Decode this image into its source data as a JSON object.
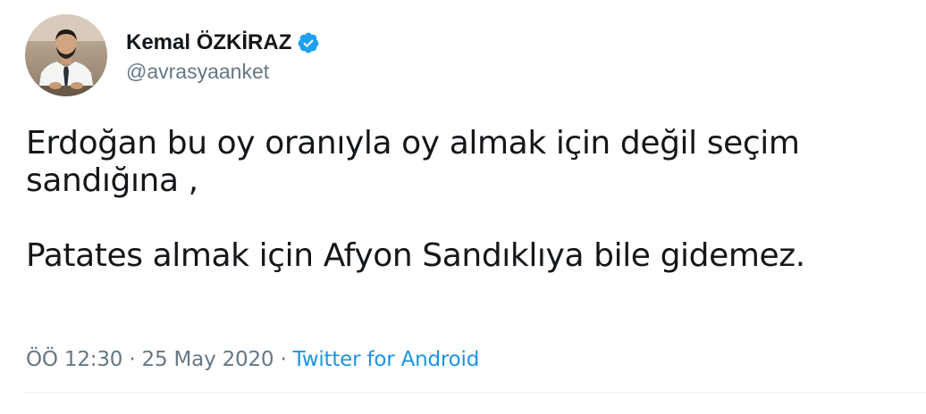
{
  "user": {
    "display_name": "Kemal ÖZKİRAZ",
    "handle": "@avrasyaanket",
    "verified": true,
    "avatar_icon": "profile-photo",
    "verified_icon": "verified-badge-icon"
  },
  "tweet": {
    "text": "Erdoğan bu oy oranıyla oy almak için değil seçim sandığına ,\n\nPatates almak için Afyon Sandıklıya bile gidemez.",
    "time": "ÖÖ 12:30",
    "separator_1": " · ",
    "date": "25 May 2020",
    "separator_2": " · ",
    "source": "Twitter for Android"
  },
  "colors": {
    "text": "#14171a",
    "secondary": "#657786",
    "link": "#1b95e0",
    "verified": "#1da1f2",
    "divider": "#e6ecf0"
  }
}
